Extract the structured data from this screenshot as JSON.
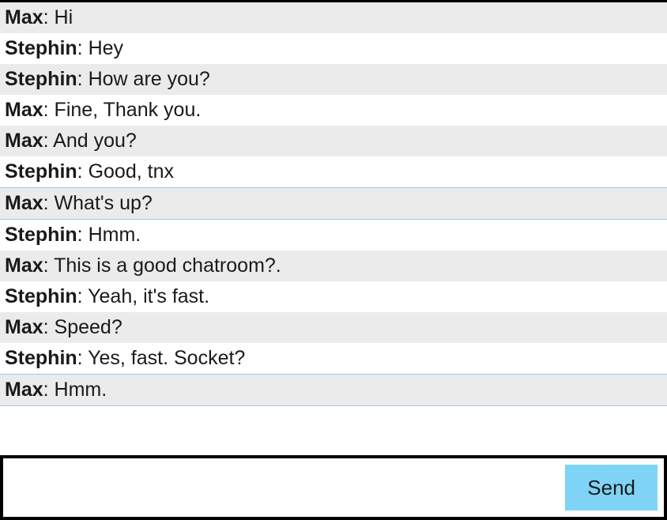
{
  "messages": [
    {
      "sender": "Max",
      "text": "Hi"
    },
    {
      "sender": "Stephin",
      "text": "Hey"
    },
    {
      "sender": "Stephin",
      "text": "How are you?"
    },
    {
      "sender": "Max",
      "text": "Fine, Thank you."
    },
    {
      "sender": "Max",
      "text": "And you?"
    },
    {
      "sender": "Stephin",
      "text": "Good, tnx"
    },
    {
      "sender": "Max",
      "text": "What's up?"
    },
    {
      "sender": "Stephin",
      "text": "Hmm."
    },
    {
      "sender": "Max",
      "text": "This is a good chatroom?."
    },
    {
      "sender": "Stephin",
      "text": "Yeah, it's fast."
    },
    {
      "sender": "Max",
      "text": "Speed?"
    },
    {
      "sender": "Stephin",
      "text": "Yes, fast. Socket?"
    },
    {
      "sender": "Max",
      "text": "Hmm."
    }
  ],
  "highlight_indexes": [
    6,
    12
  ],
  "input": {
    "value": "",
    "placeholder": ""
  },
  "buttons": {
    "send_label": "Send"
  }
}
